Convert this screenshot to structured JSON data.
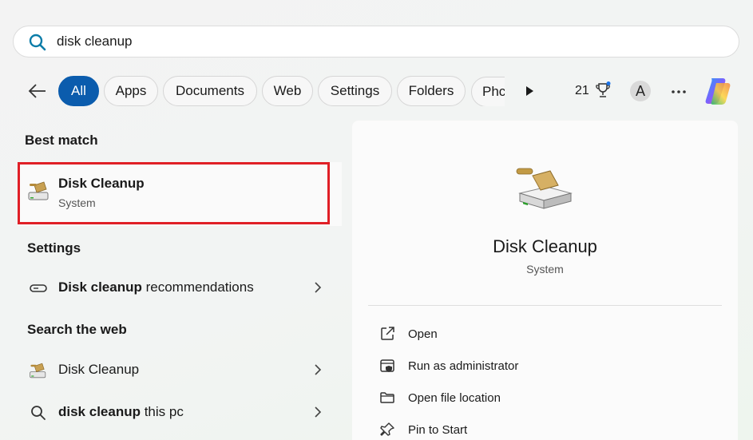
{
  "search": {
    "query": "disk cleanup"
  },
  "filters": {
    "chips": [
      "All",
      "Apps",
      "Documents",
      "Web",
      "Settings",
      "Folders",
      "Phc"
    ],
    "active": "All",
    "points": "21",
    "avatar_letter": "A"
  },
  "results": {
    "best_match_header": "Best match",
    "best_match": {
      "title": "Disk Cleanup",
      "subtitle": "System"
    },
    "settings_header": "Settings",
    "settings_item": {
      "bold": "Disk cleanup",
      "rest": " recommendations"
    },
    "web_header": "Search the web",
    "web_items": [
      {
        "bold": "",
        "rest": "Disk Cleanup"
      },
      {
        "bold": "disk cleanup",
        "rest": " this pc"
      }
    ]
  },
  "preview": {
    "title": "Disk Cleanup",
    "subtitle": "System",
    "actions": [
      "Open",
      "Run as administrator",
      "Open file location",
      "Pin to Start"
    ]
  },
  "colors": {
    "accent": "#0b5cad",
    "highlight_border": "#e01f26"
  }
}
